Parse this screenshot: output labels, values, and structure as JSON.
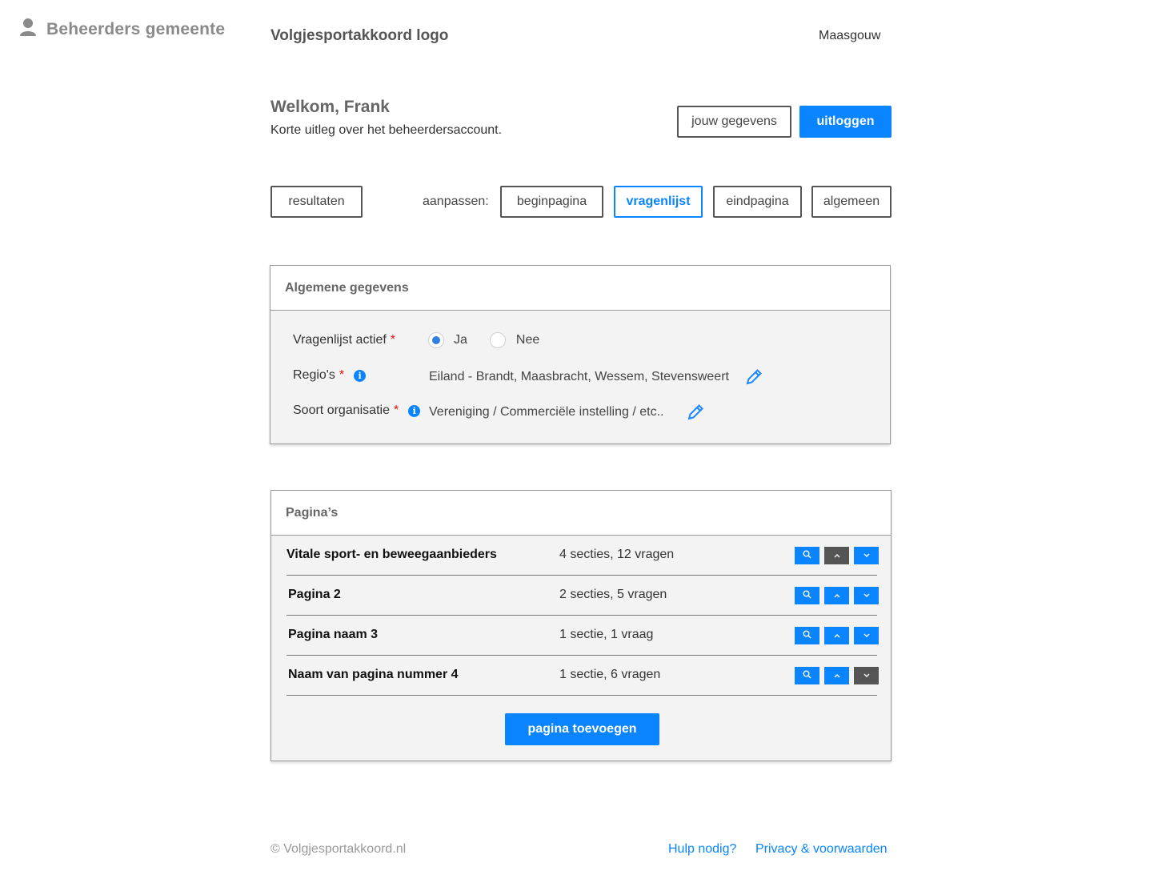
{
  "sidebar": {
    "title": "Beheerders gemeente"
  },
  "header": {
    "logo": "Volgjesportakkoord logo",
    "municipality": "Maasgouw"
  },
  "welcome": {
    "title": "Welkom, Frank",
    "subtitle": "Korte uitleg over het beheerdersaccount.",
    "account_button": "jouw gegevens",
    "logout_button": "uitloggen"
  },
  "nav": {
    "results": "resultaten",
    "customize_label": "aanpassen:",
    "tabs": [
      "beginpagina",
      "vragenlijst",
      "eindpagina",
      "algemeen"
    ],
    "active_tab": "vragenlijst"
  },
  "general": {
    "title": "Algemene gegevens",
    "active_label": "Vragenlijst actief",
    "option_yes": "Ja",
    "option_no": "Nee",
    "selected": "Ja",
    "regions_label": "Regio's",
    "regions_value": "Eiland - Brandt, Maasbracht, Wessem, Stevensweert",
    "org_label": "Soort organisatie",
    "org_value": "Vereniging / Commerciële instelling / etc..",
    "required_mark": "*",
    "info_glyph": "i"
  },
  "pages": {
    "title": "Pagina’s",
    "rows": [
      {
        "name": "Vitale sport- en beweegaanbieders",
        "count": "4 secties, 12 vragen"
      },
      {
        "name": "Pagina 2",
        "count": "2 secties, 5 vragen"
      },
      {
        "name": "Pagina naam 3",
        "count": "1 sectie, 1 vraag"
      },
      {
        "name": "Naam van pagina nummer 4",
        "count": "1 sectie, 6 vragen"
      }
    ],
    "add_button": "pagina toevoegen"
  },
  "footer": {
    "copyright": "© Volgjesportakkoord.nl",
    "help": "Hulp nodig?",
    "privacy": "Privacy & voorwaarden"
  },
  "colors": {
    "accent": "#0a84ff",
    "disabled": "#555555",
    "required": "#e01010"
  }
}
